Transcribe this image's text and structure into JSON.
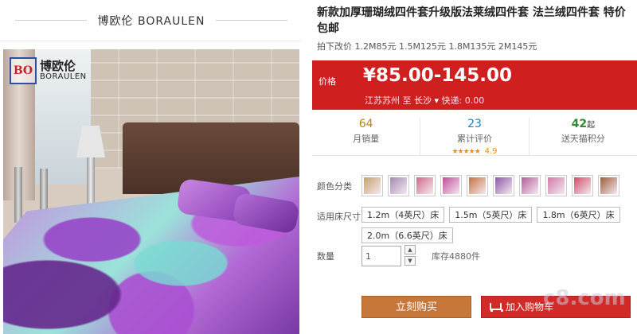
{
  "brand_bar": {
    "text": "博欧伦  BORAULEN"
  },
  "photo": {
    "logo_mark": "BO",
    "logo_cn": "博欧伦",
    "logo_en": "BORAULEN"
  },
  "product": {
    "title": "新款加厚珊瑚绒四件套升级版法莱绒四件套 法兰绒四件套 特价包邮",
    "subtitle": "拍下改价 1.2M85元 1.5M125元 1.8M135元 2M145元"
  },
  "price": {
    "label": "价格",
    "value": "¥85.00-145.00",
    "ship_from": "江苏苏州",
    "ship_to_word": "至",
    "ship_dest": "长沙",
    "express": "快递: 0.00"
  },
  "stats": {
    "monthly_sales": {
      "num": "64",
      "label": "月销量"
    },
    "reviews": {
      "num": "23",
      "label": "累计评价",
      "stars": "★★★★★",
      "score": "4.9"
    },
    "points": {
      "num": "42",
      "suffix": "起",
      "label": "送天猫积分"
    }
  },
  "colors": {
    "label": "颜色分类",
    "swatches": [
      "#c9a06a",
      "#a38ab0",
      "#d06a8a",
      "#c04e9a",
      "#c7723f",
      "#8e59a8",
      "#b45f9a",
      "#d07aa8",
      "#cf4f6a",
      "#9e5d3a"
    ]
  },
  "sizes": {
    "label": "适用床尺寸",
    "options": [
      "1.2m（4英尺）床",
      "1.5m（5英尺）床",
      "1.8m（6英尺）床",
      "2.0m（6.6英尺）床"
    ]
  },
  "quantity": {
    "label": "数量",
    "value": "1",
    "stock": "库存4880件"
  },
  "buttons": {
    "buy": "立刻购买",
    "cart": "加入购物车"
  },
  "watermark": "c8.com"
}
